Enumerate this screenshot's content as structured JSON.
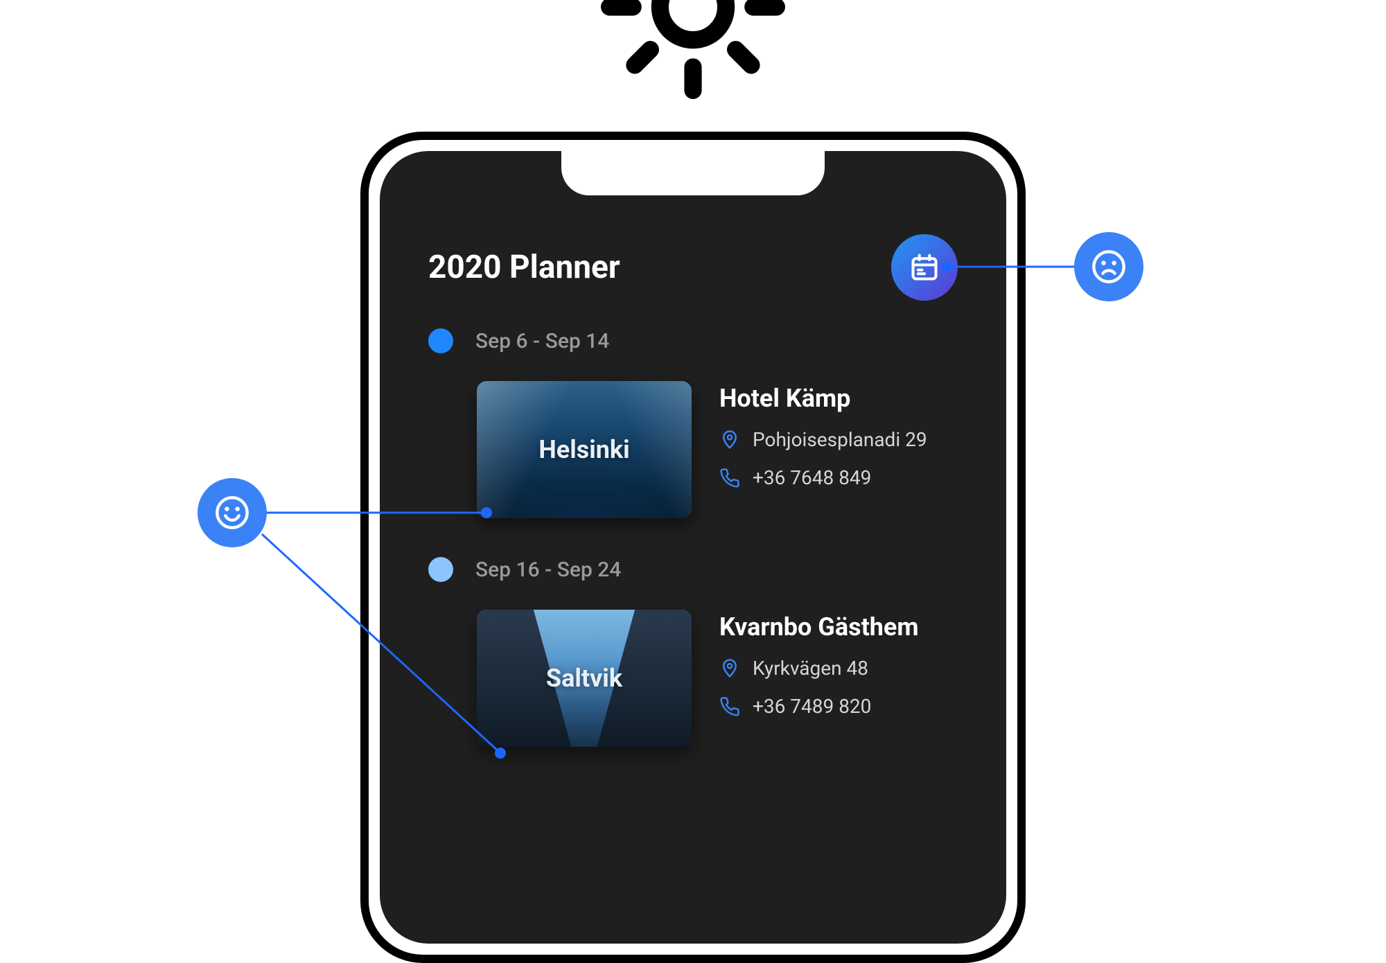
{
  "planner": {
    "title": "2020 Planner",
    "calendar_button_icon": "calendar-icon",
    "trips": [
      {
        "date_range": "Sep 6 - Sep 14",
        "dot_color": "#1e88ff",
        "destination_label": "Helsinki",
        "hotel_name": "Hotel Kämp",
        "address": "Pohjoisesplanadi 29",
        "phone": "+36 7648 849"
      },
      {
        "date_range": "Sep 16 - Sep 24",
        "dot_color": "#8cc4ff",
        "destination_label": "Saltvik",
        "hotel_name": "Kvarnbo Gästhem",
        "address": "Kyrkvägen 48",
        "phone": "+36 7489 820"
      }
    ]
  },
  "annotations": {
    "sad_icon": "frown-icon",
    "smile_icon": "smile-icon"
  },
  "colors": {
    "accent_blue": "#1e88ff",
    "gradient_start": "#2196f3",
    "gradient_end": "#5b3bd4",
    "callout_bg": "#3b82f6"
  }
}
